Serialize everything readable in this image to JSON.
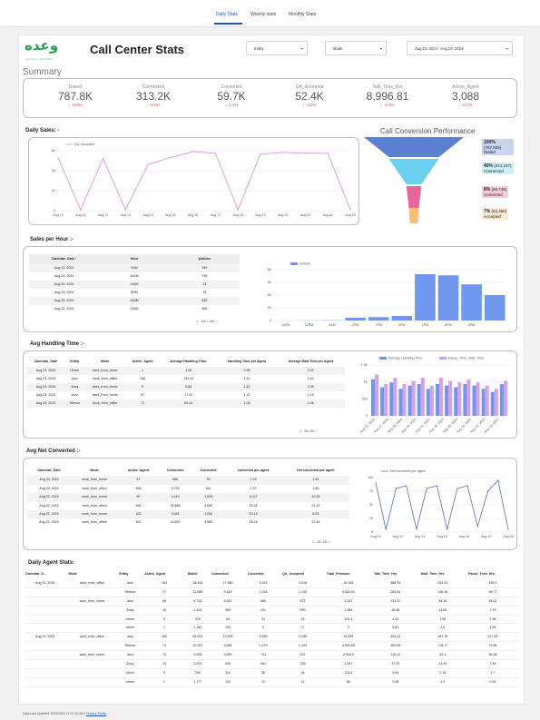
{
  "nav": {
    "tabs": [
      "Daily Stats",
      "Weekly stats",
      "Monthly Stats"
    ]
  },
  "header": {
    "logo": "وعده",
    "logo_sub": "Insurance simplified",
    "title": "Call Center Stats",
    "entity_label": "Entity",
    "mode_label": "Mode",
    "date_range": "Aug 10, 2024 - Aug 23, 2024"
  },
  "summary": {
    "title": "Summary",
    "kpis": [
      {
        "label": "Dialed",
        "value": "787.8K",
        "delta": "↓ -8.8%"
      },
      {
        "label": "Connected",
        "value": "313.2K",
        "delta": "↓ -6.5%"
      },
      {
        "label": "Converted",
        "value": "59.7K",
        "delta": "↓ -1.2%"
      },
      {
        "label": "QA_Accepted",
        "value": "52.4K",
        "delta": "↓ -3.2%"
      },
      {
        "label": "Talk_Time_Hrs",
        "value": "8,996.81",
        "delta": "↓ -2.5%"
      },
      {
        "label": "Active_Agent",
        "value": "3,088",
        "delta": "↓ -0.7%"
      }
    ]
  },
  "daily_sales": {
    "title": "Daily Sales: -",
    "legend": "QA_Accepted",
    "yticks": [
      "6K",
      "4K",
      "2K",
      "0"
    ]
  },
  "funnel": {
    "title": "Call Conversion Performance",
    "colors": [
      "#5b7fd1",
      "#6bd0ef",
      "#e7679a",
      "#f6bf72"
    ],
    "stages": [
      {
        "pct": "100%",
        "val": "(787,825)",
        "name": "Dialed"
      },
      {
        "pct": "40%",
        "val": "(313,157)",
        "name": "Connected"
      },
      {
        "pct": "8%",
        "val": "(59,745)",
        "name": "Converted"
      },
      {
        "pct": "7%",
        "val": "(52,350)",
        "name": "Accepted"
      }
    ]
  },
  "sales_hour": {
    "title": "Sales per Hour :-",
    "headers": [
      "Calendar_Date ↓",
      "Hour",
      "policies"
    ],
    "rows": [
      [
        "Aug 23, 2024",
        "9AM",
        "289"
      ],
      [
        "Aug 23, 2024",
        "10AM",
        "799"
      ],
      [
        "Aug 23, 2024",
        "11AM",
        "13"
      ],
      [
        "Aug 23, 2024",
        "6PM",
        "14"
      ],
      [
        "Aug 23, 2024",
        "10AM",
        "839"
      ],
      [
        "Aug 23, 2024",
        "11AM",
        "685"
      ]
    ],
    "pager": "1 - 100 / 148",
    "legend": "policies",
    "yticks": [
      "8K",
      "6K",
      "4K",
      "2K",
      "0"
    ],
    "xcats": [
      "11PM",
      "12PM",
      "9AM",
      "2PM",
      "7PM",
      "3PM",
      "1PM",
      "6PM",
      "3PM"
    ]
  },
  "aht": {
    "title": "Avg Handling Time :-",
    "headers": [
      "Calendar_Date",
      "Entity",
      "Mode",
      "Active_Agent",
      "Average Handling Time:",
      "Handling Time per Agent",
      "Average Wait Time per Agent"
    ],
    "rows": [
      [
        "Aug 23, 2024",
        "Ufone",
        "work_from_home",
        "1",
        "1.05",
        "0.95",
        "2.22"
      ],
      [
        "Aug 23, 2024",
        "Jazz",
        "work_from_office",
        "186",
        "131.34",
        "1.11",
        "1.44"
      ],
      [
        "Aug 23, 2024",
        "Zong",
        "work_from_home",
        "9",
        "6.83",
        "1.42",
        "2.39"
      ],
      [
        "Aug 23, 2024",
        "Jazz",
        "work_from_home",
        "37",
        "17.92",
        "1.21",
        "2.19"
      ],
      [
        "Aug 23, 2024",
        "Telenor",
        "work_from_office",
        "71",
        "69.14",
        "1.09",
        "1.46"
      ]
    ],
    "pager": "1 - 56 / 56",
    "legend": [
      "Average Handling Time",
      "Pause_Time_Wait_Time"
    ],
    "yticks": [
      "1.5K",
      "1K",
      "500",
      "0"
    ],
    "xcats": [
      "Aug 12, 2024",
      "Aug 27, 2024",
      "Aug 20, 2024",
      "Aug 16, 2024",
      "Aug 14, 2024",
      "Aug 18, 2024",
      "Aug 19, 2024",
      "Aug 10, 2024",
      "Aug 14, 2024",
      "Aug 13, 2024"
    ]
  },
  "anc": {
    "title": "Avg Net Converted :-",
    "headers": [
      "Calendar_Date",
      "Mode",
      "Active_Agent",
      "Connected",
      "Converted",
      "converted per agent",
      "Net converted per agent"
    ],
    "rows": [
      [
        "Aug 23, 2024",
        "work_from_home",
        "37",
        "856",
        "90",
        "2.43",
        "1.62"
      ],
      [
        "Aug 23, 2024",
        "work_from_office",
        "306",
        "5,793",
        "541",
        "2.37",
        "1.85"
      ],
      [
        "Aug 22, 2024",
        "work_from_home",
        "90",
        "4,419",
        "1,053",
        "11.67",
        "10.28"
      ],
      [
        "Aug 22, 2024",
        "work_from_office",
        "306",
        "25,889",
        "4,659",
        "24.31",
        "21.19"
      ],
      [
        "Aug 21, 2024",
        "work_from_home",
        "103",
        "4,691",
        "1,056",
        "10.14",
        "8.93"
      ],
      [
        "Aug 21, 2024",
        "work_from_office",
        "302",
        "24,657",
        "5,585",
        "25.24",
        "22.48"
      ]
    ],
    "pager": "1 - 28 / 28",
    "legend": "Net converted per agent",
    "yticks": [
      "100",
      "75",
      "50",
      "25",
      "0"
    ],
    "xcats": [
      "Aug 10",
      "Aug 12",
      "Aug 14",
      "Aug 16",
      "Aug 18",
      "Aug 20",
      "Aug 22"
    ]
  },
  "agent": {
    "title": "Daily Agent Stats:",
    "headers": [
      "Calendar_D...",
      "Mode",
      "Entity",
      "Active_Agent",
      "Dialed",
      "Connected",
      "Converted",
      "QA_Accepted",
      "Total_Premium",
      "Talk_Time_Hrs",
      "Wait_Time_Hrs",
      "Pause_Time_Hrs"
    ],
    "rows": [
      [
        "Aug 21, 2024",
        "work_from_office",
        "Jazz",
        "184",
        "38,444",
        "17,380",
        "3,923",
        "3,418",
        "14,155",
        "668.35",
        "204.31",
        "339.2"
      ],
      [
        "",
        "",
        "Telenor",
        "71",
        "31,685",
        "9,425",
        "1,318",
        "1,140",
        "4,834.01",
        "280.84",
        "148.38",
        "96.77"
      ],
      [
        "",
        "work_from_home",
        "Jazz",
        "80",
        "8,718",
        "3,620",
        "680",
        "571",
        "2,317",
        "131.22",
        "48.15",
        "64.42"
      ],
      [
        "",
        "",
        "Zong",
        "15",
        "2,434",
        "984",
        "201",
        "209",
        "1,384",
        "26.98",
        "14.06",
        "7.78"
      ],
      [
        "",
        "",
        "Ufone",
        "3",
        "315",
        "64",
        "31",
        "29",
        "104.4",
        "4.42",
        "1.96",
        "1.98"
      ],
      [
        "",
        "",
        "Ufone",
        "1",
        "1,182",
        "153",
        "0",
        "0",
        "0",
        "5.81",
        "1.8",
        "1.28"
      ],
      [
        "Aug 22, 2024",
        "work_from_office",
        "Jazz",
        "183",
        "65,201",
        "12,999",
        "3,460",
        "2,186",
        "14,559",
        "454.33",
        "187.78",
        "317.69"
      ],
      [
        "",
        "",
        "Telenor",
        "74",
        "32,357",
        "9,684",
        "1,379",
        "1,193",
        "4,903.69",
        "300.89",
        "178.17",
        "70.85"
      ],
      [
        "",
        "work_from_home",
        "Jazz",
        "73",
        "9,005",
        "3,859",
        "741",
        "621",
        "2,916.5",
        "115.13",
        "42.4",
        "56.38"
      ],
      [
        "",
        "",
        "Zong",
        "13",
        "2,001",
        "930",
        "261",
        "236",
        "1,057",
        "37.33",
        "14.59",
        "7.83"
      ],
      [
        "",
        "",
        "Ufone",
        "3",
        "259",
        "110",
        "36",
        "36",
        "124.5",
        "5.54",
        "2.18",
        "1.7"
      ],
      [
        "",
        "",
        "Ufone",
        "1",
        "1,177",
        "120",
        "12",
        "12",
        "86",
        "5.38",
        "1.9",
        "0.45"
      ]
    ],
    "pager": "1 - 56 / 56"
  },
  "footer": {
    "updated": "Data Last Updated: 8/26/2024 17:22:00 AM",
    "privacy": "Privacy Policy"
  },
  "chart_data": [
    {
      "type": "line",
      "title": "Daily Sales: -",
      "series": [
        {
          "name": "QA_Accepted",
          "values": [
            6200,
            100,
            6100,
            100,
            5400,
            6200,
            6900,
            6700,
            100,
            6600,
            6800,
            6700,
            6700,
            100
          ]
        }
      ],
      "categories": [
        "Aug 10",
        "Aug 11",
        "Aug 12",
        "Aug 13",
        "Aug 14",
        "Aug 15",
        "Aug 16",
        "Aug 17",
        "Aug 18",
        "Aug 19",
        "Aug 20",
        "Aug 21",
        "Aug 22",
        "Aug 23"
      ],
      "ylim": [
        0,
        7000
      ],
      "grid": true,
      "legend": "top-left"
    },
    {
      "type": "bar",
      "title": "Sales per Hour :-",
      "series": [
        {
          "name": "policies",
          "values": [
            10,
            30,
            60,
            500,
            600,
            800,
            8200,
            8000,
            6400,
            4500
          ]
        }
      ],
      "categories": [
        "11PM",
        "12PM",
        "9AM",
        "2PM",
        "7PM",
        "3PM",
        "1PM",
        "",
        "6PM",
        "3PM"
      ],
      "ylim": [
        0,
        9000
      ],
      "grid": true,
      "legend": "top-left"
    },
    {
      "type": "bar",
      "title": "Avg Handling Time :-",
      "series": [
        {
          "name": "Average Handling Time",
          "values": [
            1150,
            900,
            1050,
            850,
            950,
            1000,
            850,
            1000,
            950,
            900,
            1000,
            950,
            850,
            750,
            1000
          ]
        },
        {
          "name": "Pause_Time_Wait_Time",
          "values": [
            1300,
            1000,
            1200,
            1000,
            1100,
            1200,
            950,
            1200,
            1100,
            1050,
            1150,
            1050,
            950,
            850,
            1100
          ]
        }
      ],
      "categories": [
        "Aug 12, 2024",
        "",
        "Aug 27, 2024",
        "",
        "Aug 20, 2024",
        "",
        "Aug 16, 2024",
        "",
        "Aug 14, 2024",
        "",
        "Aug 18, 2024",
        "Aug 19, 2024",
        "Aug 10, 2024",
        "Aug 14, 2024",
        "Aug 13, 2024"
      ],
      "ylim": [
        0,
        1600
      ],
      "grid": true,
      "legend": "top"
    },
    {
      "type": "line",
      "title": "Avg Net Converted :-",
      "series": [
        {
          "name": "Net converted per agent",
          "values": [
            90,
            5,
            80,
            85,
            5,
            80,
            85,
            5,
            80,
            85,
            10,
            75,
            95,
            5
          ]
        }
      ],
      "categories": [
        "Aug 10",
        "Aug 11",
        "Aug 12",
        "Aug 13",
        "Aug 14",
        "Aug 15",
        "Aug 16",
        "Aug 17",
        "Aug 18",
        "Aug 19",
        "Aug 20",
        "Aug 21",
        "Aug 22",
        "Aug 23"
      ],
      "ylim": [
        0,
        100
      ],
      "grid": true,
      "legend": "top-left"
    }
  ]
}
